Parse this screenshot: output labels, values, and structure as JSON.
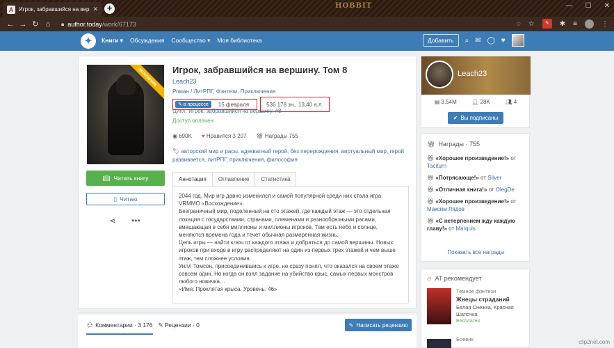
{
  "browser": {
    "tab_title": "Игрок, забравшийся на вершину",
    "tab_close": "✕",
    "new_tab": "+",
    "theme_logo": "HOBBIT",
    "url_host": "author.today",
    "url_path": "/work/67173",
    "window_controls": [
      "—",
      "☐",
      "✕"
    ]
  },
  "header": {
    "nav": [
      "Книги ▾",
      "Обсуждения",
      "Сообщество ▾",
      "Моя библиотека"
    ],
    "add_button": "Добавить"
  },
  "book": {
    "ribbon": "эксклюзив",
    "title": "Игрок, забравшийся на вершину. Том 8",
    "author": "Leach23",
    "genres": "Роман / ЛитРПГ, Фэнтези, Приключения",
    "status_badge": "в процессе",
    "date": "15 февраля",
    "size": "536 178 зн., 13,40 а.л.",
    "cycle_label": "Цикл:",
    "cycle": "Игрок, забравшийся на вершину. #8",
    "access": "Доступ оплачен",
    "views": "690K",
    "likes": "Нравится 3 207",
    "awards": "Награды 755",
    "tags": "авторский мир и расы, адекватный герой, без перерождения, виртуальный мир, герой развивается, литРПГ, приключения, философия",
    "read_button": "Читать книгу",
    "reading_button": "Читаю"
  },
  "tabs": [
    "Аннотация",
    "Оглавление",
    "Статистика"
  ],
  "annotation": [
    "2044 год. Мир игр давно изменился и самой популярной среди них стала игра VRMMO «Восхождение».",
    "Безграничный мир, поделенный на сто этажей, где каждый этаж — это отдельная локация с государствами, странами, племенами и разнообразными расами, вмещающая в себя миллионы и миллионы игроков. Там есть небо и солнце, меняются времена года и течет обычная размеренная жизнь.",
    "Цель игры — найти ключ от каждого этажа и добраться до самой вершины. Новых игроков при входе в игру распределяют на один из первых трех этажей и чем выше этаж, тем сложнее условия.",
    "Уилл Томсон, присоединившись к игре, не сразу понял, что оказался на своем этаже совсем один. Но когда он взял задание на убийство крыс, самых первых монстров любого новичка…",
    "«Имя: Проклятая крыса. Уровень: 46»"
  ],
  "bottom": {
    "comments": "Комментарии · 3 176",
    "reviews": "Рецензии · 0",
    "review_button": "Написать рецензию"
  },
  "author_card": {
    "name": "Leach23",
    "works": "3,54M",
    "followers": "28K",
    "friends": "4",
    "subscribed_button": "Вы подписаны"
  },
  "awards_panel": {
    "title": "Награды · 755",
    "items": [
      {
        "name": "«Хорошее произведение!»",
        "sep": " от ",
        "user": "Taciturn"
      },
      {
        "name": "«Потрясающе!»",
        "sep": " от ",
        "user": "Silver"
      },
      {
        "name": "«Отличная книга!»",
        "sep": " от ",
        "user": "OlegDe"
      },
      {
        "name": "«Хорошее произведение!»",
        "sep": " от ",
        "user": "Максим Лядов"
      },
      {
        "name": "«С нетерпением жду каждую главу!»",
        "sep": " от ",
        "user": "Marquis"
      }
    ],
    "show_all": "Показать все награды"
  },
  "recommendations": {
    "title": "AT рекомендует",
    "items": [
      {
        "genre": "Темное фэнтези",
        "name": "Жнецы страданий",
        "authors": "Белая Снежка, Красная Шапочка",
        "price": "Бесплатно"
      },
      {
        "genre": "Боевик"
      }
    ]
  },
  "watermark": "clip2net.com",
  "colors": {
    "brand": "#3e7cb5",
    "read": "#58b14c",
    "highlight": "#d02828"
  }
}
